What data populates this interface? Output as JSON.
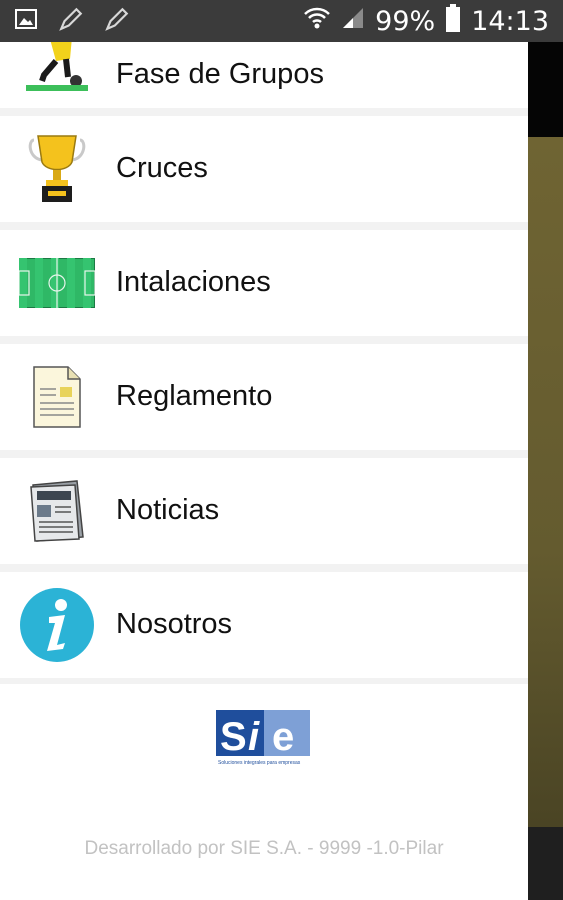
{
  "status_bar": {
    "battery": "99%",
    "time": "14:13",
    "icons": [
      "image-icon",
      "pencil-icon",
      "pencil-icon",
      "wifi-icon",
      "signal-icon",
      "battery-icon"
    ]
  },
  "menu": {
    "items": [
      {
        "label": "Fase de Grupos",
        "icon": "soccer-player-icon"
      },
      {
        "label": "Cruces",
        "icon": "trophy-icon"
      },
      {
        "label": "Intalaciones",
        "icon": "soccer-field-icon"
      },
      {
        "label": "Reglamento",
        "icon": "document-icon"
      },
      {
        "label": "Noticias",
        "icon": "newspaper-icon"
      },
      {
        "label": "Nosotros",
        "icon": "info-icon"
      }
    ]
  },
  "footer": {
    "logo_text": "SIE",
    "logo_tagline": "Soluciones integrales para empresas",
    "credit": "Desarrollado por SIE S.A. - 9999 -1.0-Pilar"
  },
  "colors": {
    "drawer_bg": "#ffffff",
    "status_bar": "#3b3b3b",
    "info_blue": "#2bb3d6",
    "logo_blue": "#1f4e9c"
  }
}
